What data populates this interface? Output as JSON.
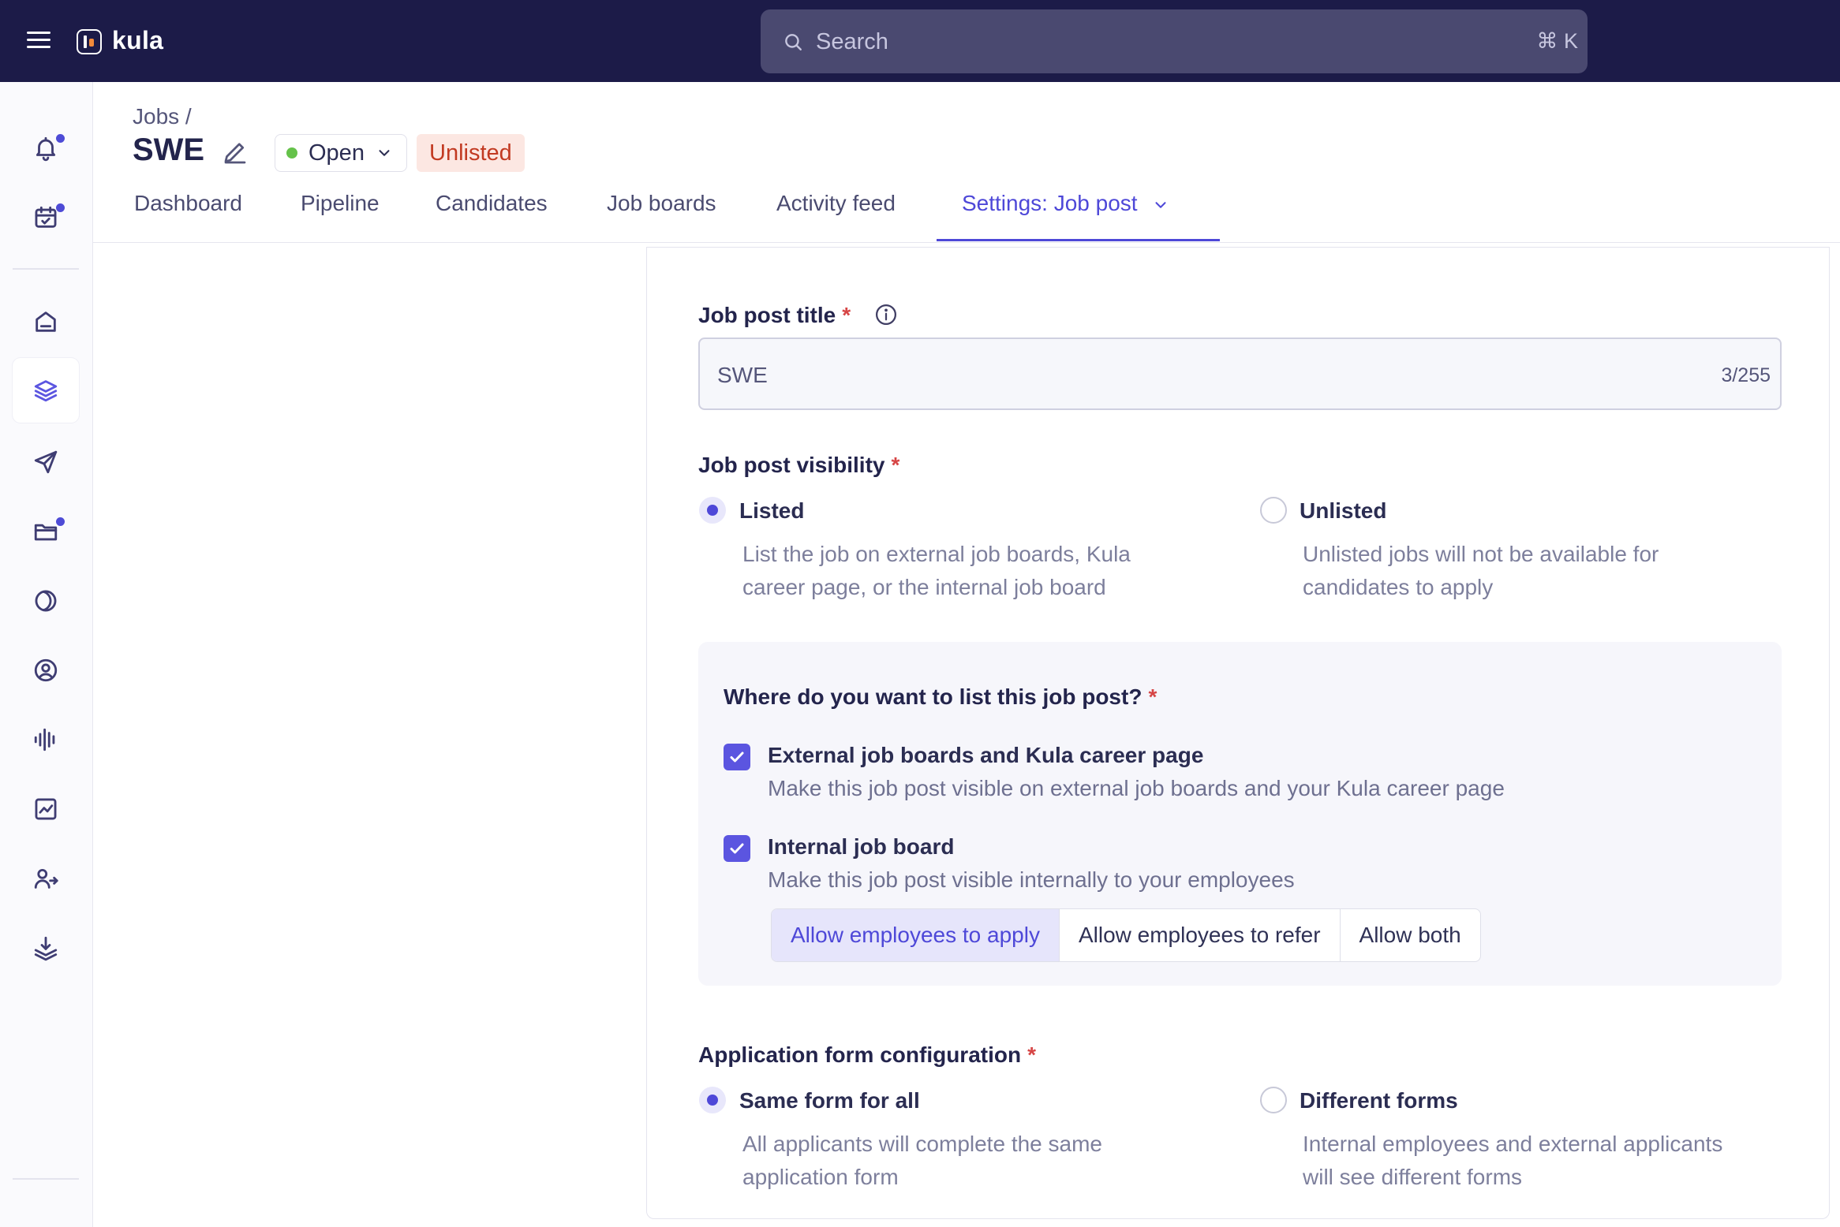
{
  "topbar": {
    "brand": "kula",
    "search_placeholder": "Search",
    "search_shortcut": "⌘ K"
  },
  "sidebar": {
    "items": [
      {
        "icon": "bell-icon",
        "has_dot": true
      },
      {
        "icon": "calendar-check-icon",
        "has_dot": true
      },
      {
        "icon": "home-icon",
        "has_dot": false
      },
      {
        "icon": "layers-icon",
        "has_dot": false,
        "active": true
      },
      {
        "icon": "send-icon",
        "has_dot": false
      },
      {
        "icon": "folder-icon",
        "has_dot": true
      },
      {
        "icon": "moon-circle-icon",
        "has_dot": false
      },
      {
        "icon": "user-circle-icon",
        "has_dot": false
      },
      {
        "icon": "audio-wave-icon",
        "has_dot": false
      },
      {
        "icon": "chart-icon",
        "has_dot": false
      },
      {
        "icon": "users-refer-icon",
        "has_dot": false
      },
      {
        "icon": "layers-download-icon",
        "has_dot": false
      }
    ]
  },
  "header": {
    "breadcrumb": "Jobs /",
    "title": "SWE",
    "status": "Open",
    "status_color": "#65c24a",
    "visibility_badge": "Unlisted"
  },
  "tabs": [
    {
      "label": "Dashboard"
    },
    {
      "label": "Pipeline"
    },
    {
      "label": "Candidates"
    },
    {
      "label": "Job boards"
    },
    {
      "label": "Activity feed"
    },
    {
      "label": "Settings: Job post",
      "active": true
    }
  ],
  "form": {
    "job_post_title": {
      "label": "Job post title",
      "required_mark": "*",
      "value": "SWE",
      "counter": "3/255"
    },
    "visibility": {
      "label": "Job post visibility",
      "required_mark": "*",
      "options": [
        {
          "title": "Listed",
          "desc_line1": "List the job on external job boards, Kula",
          "desc_line2": "career page, or the internal job board",
          "selected": true
        },
        {
          "title": "Unlisted",
          "desc_line1": "Unlisted jobs will not be available for",
          "desc_line2": "candidates to apply",
          "selected": false
        }
      ]
    },
    "listing": {
      "question": "Where do you want to list this job post?",
      "required_mark": "*",
      "options": [
        {
          "title": "External job boards and Kula career page",
          "desc": "Make this job post visible on external job boards and your Kula career page",
          "checked": true
        },
        {
          "title": "Internal job board",
          "desc": "Make this job post visible internally to your employees",
          "checked": true
        }
      ],
      "internal_modes": [
        {
          "label": "Allow employees to apply",
          "selected": true
        },
        {
          "label": "Allow employees to refer",
          "selected": false
        },
        {
          "label": "Allow both",
          "selected": false
        }
      ]
    },
    "application_form": {
      "label": "Application form configuration",
      "required_mark": "*",
      "options": [
        {
          "title": "Same form for all",
          "desc_line1": "All applicants will complete the same",
          "desc_line2": "application form",
          "selected": true
        },
        {
          "title": "Different forms",
          "desc_line1": "Internal employees and external applicants",
          "desc_line2": "will see different forms",
          "selected": false
        }
      ]
    }
  },
  "colors": {
    "topbar": "#1c1b48",
    "accent": "#4e48d8",
    "required": "#d64545",
    "unlisted_badge_bg": "#fce7e2",
    "unlisted_badge_text": "#c23a22"
  }
}
